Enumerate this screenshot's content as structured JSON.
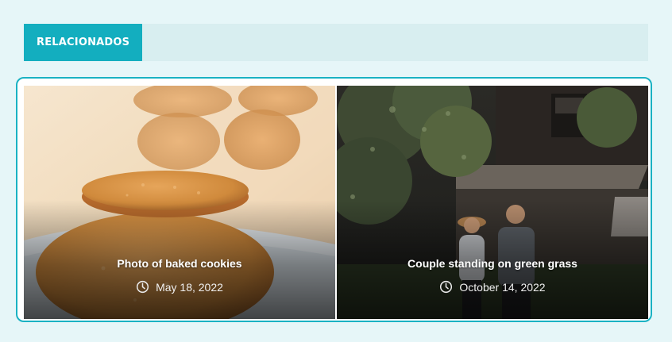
{
  "section": {
    "title": "RELACIONADOS"
  },
  "posts": [
    {
      "title": "Photo of baked cookies",
      "date": "May 18, 2022",
      "image": "baked-cookies-photo",
      "icon": "clock-icon"
    },
    {
      "title": "Couple standing on green grass",
      "date": "October 14, 2022",
      "image": "couple-near-barn-photo",
      "icon": "clock-icon"
    }
  ],
  "colors": {
    "accent": "#13aebf",
    "header_bar": "#d8eef0",
    "page_bg": "#e6f6f8",
    "frame_border": "#1ab2c3"
  }
}
